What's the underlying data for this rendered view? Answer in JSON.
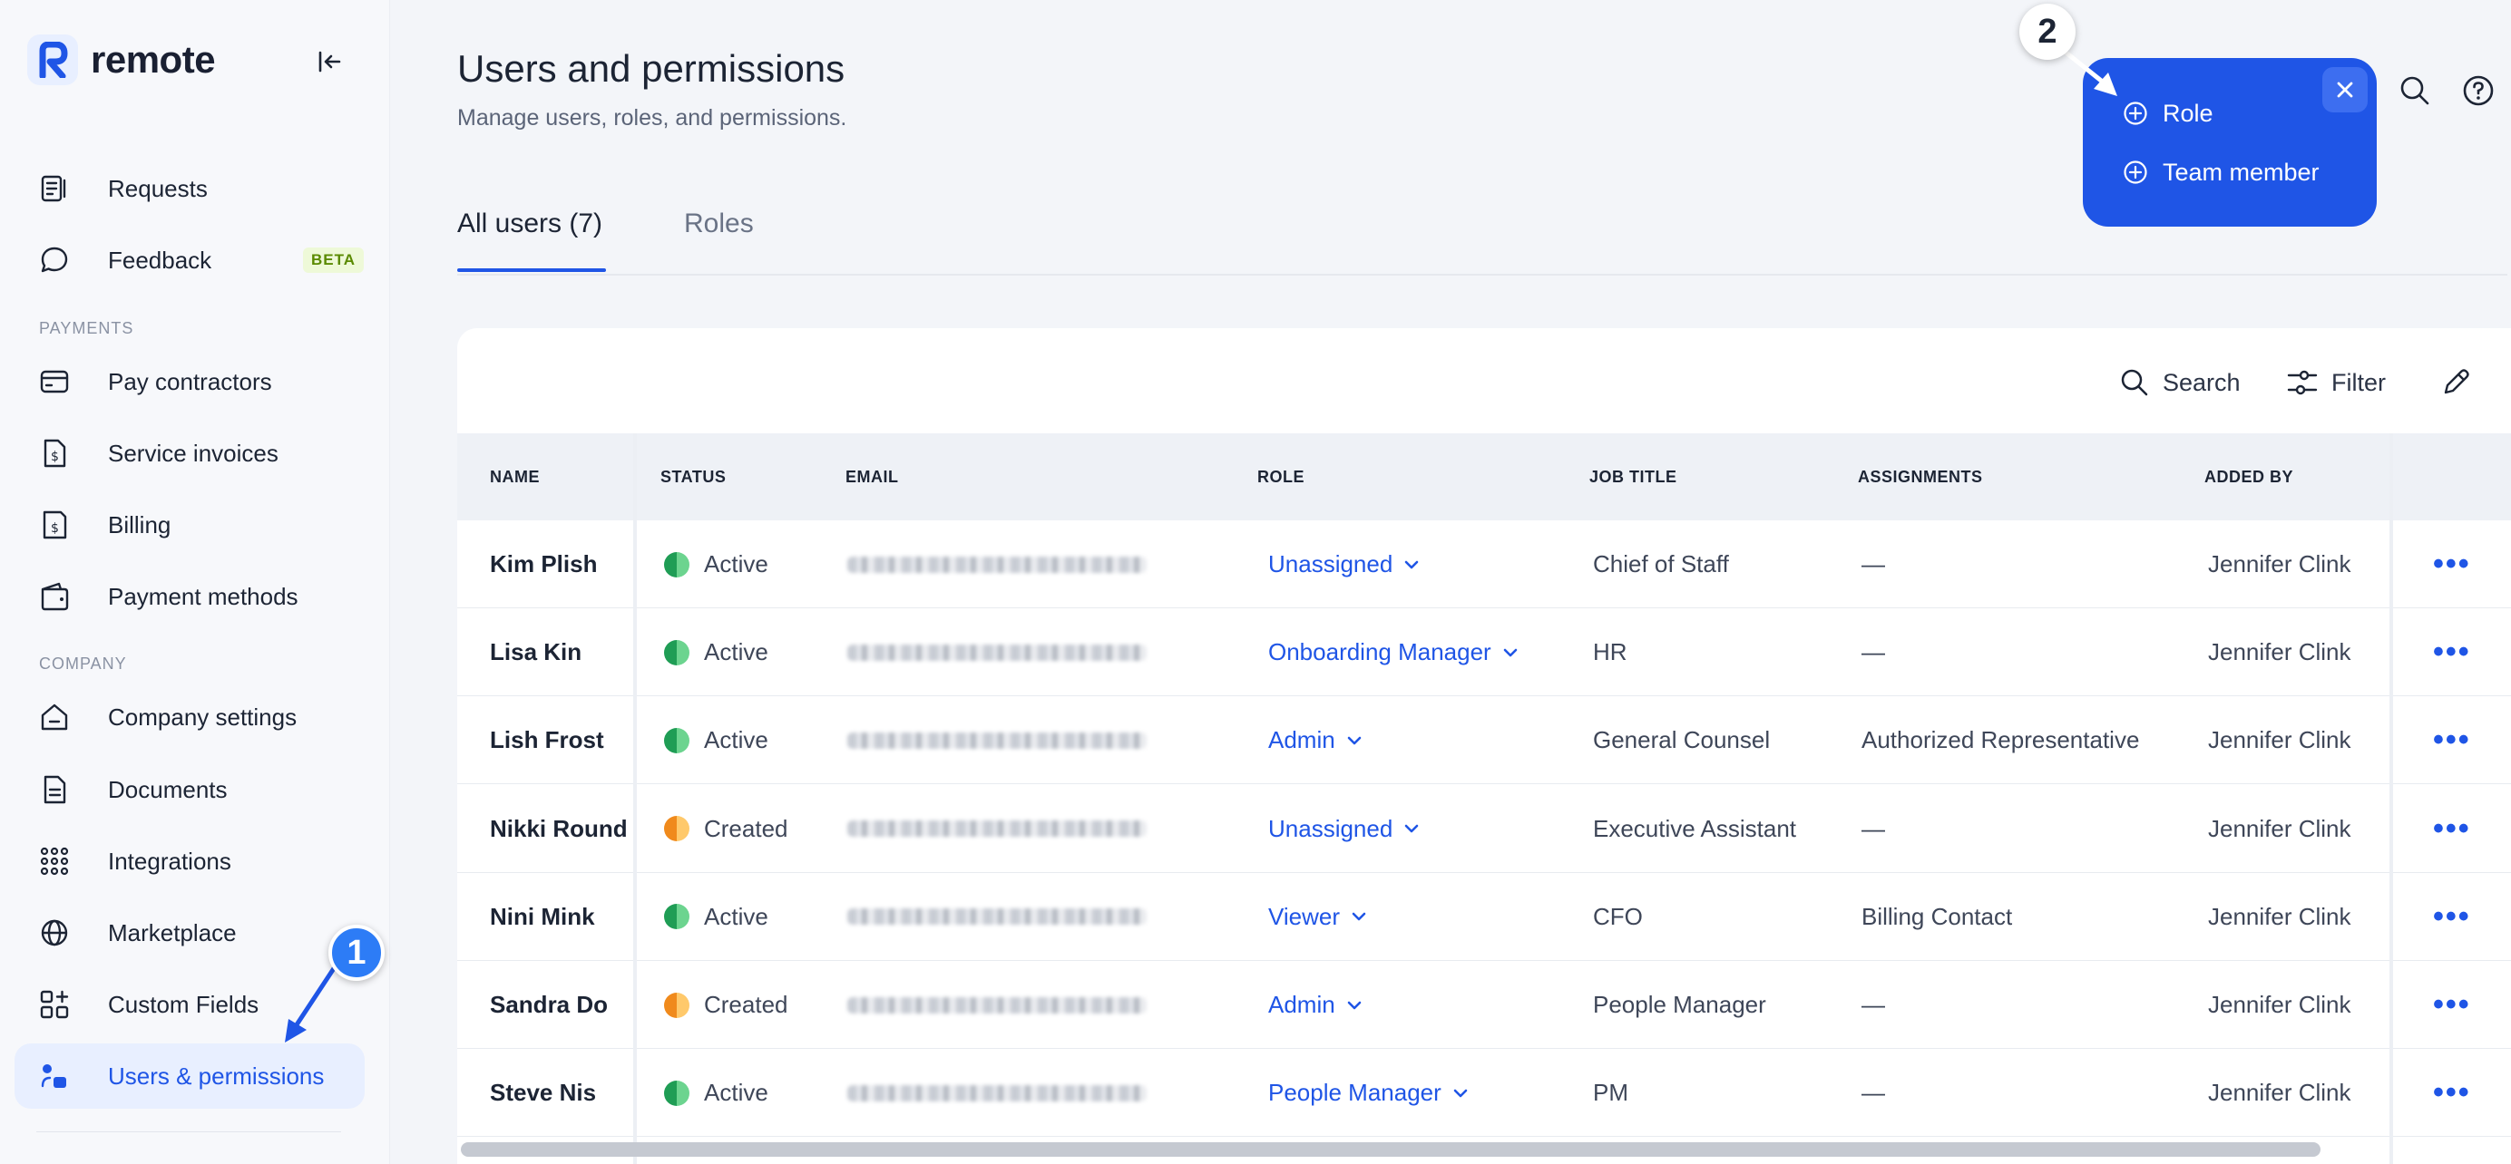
{
  "app": {
    "name": "remote",
    "brand_color": "#1f55e6"
  },
  "sidebar": {
    "items": [
      {
        "label": "Requests",
        "icon": "requests-icon"
      },
      {
        "label": "Feedback",
        "icon": "chat-bubble-icon",
        "badge": "BETA"
      },
      {
        "section": "PAYMENTS"
      },
      {
        "label": "Pay contractors",
        "icon": "card-icon"
      },
      {
        "label": "Service invoices",
        "icon": "dollar-file-icon"
      },
      {
        "label": "Billing",
        "icon": "billing-icon"
      },
      {
        "label": "Payment methods",
        "icon": "wallet-icon"
      },
      {
        "section": "COMPANY"
      },
      {
        "label": "Company settings",
        "icon": "house-icon"
      },
      {
        "label": "Documents",
        "icon": "document-icon"
      },
      {
        "label": "Integrations",
        "icon": "grid-dots-icon"
      },
      {
        "label": "Marketplace",
        "icon": "globe-icon"
      },
      {
        "label": "Custom Fields",
        "icon": "custom-fields-icon"
      },
      {
        "label": "Users & permissions",
        "icon": "users-permissions-icon",
        "active": true
      }
    ]
  },
  "header": {
    "title": "Users and permissions",
    "subtitle": "Manage users, roles, and permissions."
  },
  "tabs": [
    {
      "label": "All users (7)",
      "active": true
    },
    {
      "label": "Roles",
      "active": false
    }
  ],
  "popup": {
    "items": [
      {
        "label": "Role"
      },
      {
        "label": "Team member"
      }
    ]
  },
  "annotations": {
    "step1": "1",
    "step2": "2"
  },
  "toolbar": {
    "search_label": "Search",
    "filter_label": "Filter"
  },
  "table": {
    "columns": [
      "NAME",
      "STATUS",
      "EMAIL",
      "ROLE",
      "JOB TITLE",
      "ASSIGNMENTS",
      "ADDED BY"
    ],
    "rows": [
      {
        "name": "Kim Plish",
        "status": "Active",
        "status_type": "active",
        "role": "Unassigned",
        "job_title": "Chief of Staff",
        "assignments": "—",
        "added_by": "Jennifer Clink"
      },
      {
        "name": "Lisa Kin",
        "status": "Active",
        "status_type": "active",
        "role": "Onboarding Manager",
        "job_title": "HR",
        "assignments": "—",
        "added_by": "Jennifer Clink"
      },
      {
        "name": "Lish Frost",
        "status": "Active",
        "status_type": "active",
        "role": "Admin",
        "job_title": "General Counsel",
        "assignments": "Authorized Representative",
        "added_by": "Jennifer Clink"
      },
      {
        "name": "Nikki Round",
        "status": "Created",
        "status_type": "created",
        "role": "Unassigned",
        "job_title": "Executive Assistant",
        "assignments": "—",
        "added_by": "Jennifer Clink"
      },
      {
        "name": "Nini Mink",
        "status": "Active",
        "status_type": "active",
        "role": "Viewer",
        "job_title": "CFO",
        "assignments": "Billing Contact",
        "added_by": "Jennifer Clink"
      },
      {
        "name": "Sandra Do",
        "status": "Created",
        "status_type": "created",
        "role": "Admin",
        "job_title": "People Manager",
        "assignments": "—",
        "added_by": "Jennifer Clink"
      },
      {
        "name": "Steve Nis",
        "status": "Active",
        "status_type": "active",
        "role": "People Manager",
        "job_title": "PM",
        "assignments": "—",
        "added_by": "Jennifer Clink"
      }
    ],
    "more_label": "•••"
  }
}
